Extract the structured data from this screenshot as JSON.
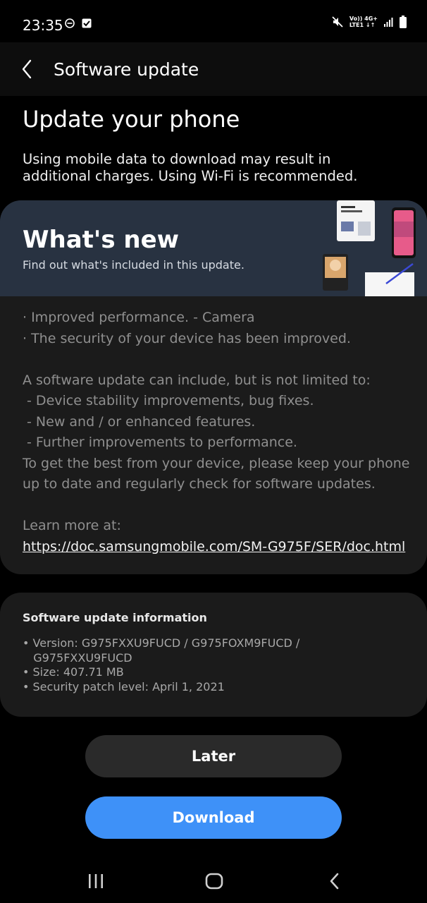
{
  "status_bar": {
    "time": "23:35",
    "network_top": "Vo)) 4G+",
    "network_bottom": "LTE1 ↓↑",
    "icons": [
      "do-not-disturb-icon",
      "checkbox-notification-icon",
      "mute-icon",
      "signal-icon",
      "battery-icon"
    ]
  },
  "header": {
    "title": "Software update"
  },
  "page": {
    "title": "Update your phone",
    "description": "Using mobile data to download may result in additional charges. Using Wi-Fi is recommended."
  },
  "whats_new": {
    "title": "What's new",
    "subtitle": "Find out what's included in this update.",
    "notes": [
      "· Improved performance. - Camera",
      "· The security of your device has been improved.",
      "",
      "A software update can include, but is not limited to:",
      " - Device stability improvements, bug fixes.",
      " - New and / or enhanced features.",
      " - Further improvements to performance.",
      "To get the best from your device, please keep your phone",
      "up to date and regularly check for software updates.",
      "",
      "Learn more at:"
    ],
    "link": "https://doc.samsungmobile.com/SM-G975F/SER/doc.html"
  },
  "info": {
    "title": "Software update information",
    "lines": [
      "• Version: G975FXXU9FUCD / G975FOXM9FUCD /",
      "   G975FXXU9FUCD",
      "• Size: 407.71 MB",
      "• Security patch level: April 1, 2021"
    ]
  },
  "buttons": {
    "later": "Later",
    "download": "Download"
  },
  "colors": {
    "accent": "#3e91f8",
    "banner": "#283241",
    "card": "#1b1b1b",
    "background": "#000000"
  }
}
